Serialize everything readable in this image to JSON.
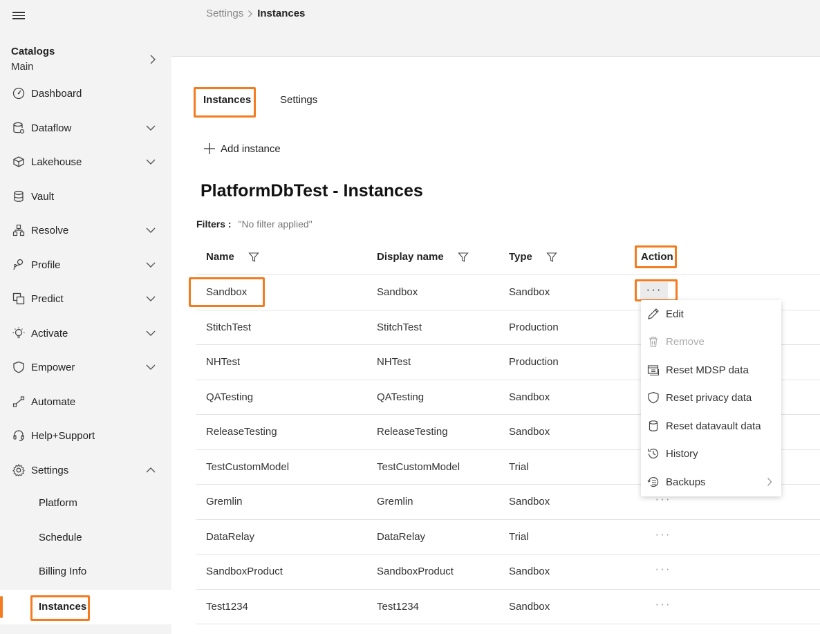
{
  "sidebar": {
    "catalogs_title": "Catalogs",
    "catalogs_sub": "Main",
    "items": [
      {
        "label": "Dashboard",
        "icon": "dashboard-icon",
        "chevron": false
      },
      {
        "label": "Dataflow",
        "icon": "dataflow-icon",
        "chevron": true
      },
      {
        "label": "Lakehouse",
        "icon": "cube-icon",
        "chevron": true
      },
      {
        "label": "Vault",
        "icon": "database-icon",
        "chevron": false
      },
      {
        "label": "Resolve",
        "icon": "hierarchy-icon",
        "chevron": true
      },
      {
        "label": "Profile",
        "icon": "profile-icon",
        "chevron": true
      },
      {
        "label": "Predict",
        "icon": "predict-icon",
        "chevron": true
      },
      {
        "label": "Activate",
        "icon": "lightbulb-icon",
        "chevron": true
      },
      {
        "label": "Empower",
        "icon": "shield-icon",
        "chevron": true
      },
      {
        "label": "Automate",
        "icon": "automate-icon",
        "chevron": false
      },
      {
        "label": "Help+Support",
        "icon": "headset-icon",
        "chevron": false
      },
      {
        "label": "Settings",
        "icon": "gear-icon",
        "chevron": "up"
      }
    ],
    "sub_items": [
      "Platform",
      "Schedule",
      "Billing Info",
      "Instances"
    ]
  },
  "breadcrumb": {
    "parent": "Settings",
    "current": "Instances"
  },
  "tabs": [
    "Instances",
    "Settings"
  ],
  "add_instance_label": "Add instance",
  "page_title": "PlatformDbTest - Instances",
  "filters": {
    "label": "Filters :",
    "value": "\"No filter applied\""
  },
  "table": {
    "headers": [
      "Name",
      "Display name",
      "Type",
      "Action"
    ],
    "rows": [
      {
        "name": "Sandbox",
        "display": "Sandbox",
        "type": "Sandbox"
      },
      {
        "name": "StitchTest",
        "display": "StitchTest",
        "type": "Production"
      },
      {
        "name": "NHTest",
        "display": "NHTest",
        "type": "Production"
      },
      {
        "name": "QATesting",
        "display": "QATesting",
        "type": "Sandbox"
      },
      {
        "name": "ReleaseTesting",
        "display": "ReleaseTesting",
        "type": "Sandbox"
      },
      {
        "name": "TestCustomModel",
        "display": "TestCustomModel",
        "type": "Trial"
      },
      {
        "name": "Gremlin",
        "display": "Gremlin",
        "type": "Sandbox"
      },
      {
        "name": "DataRelay",
        "display": "DataRelay",
        "type": "Trial"
      },
      {
        "name": "SandboxProduct",
        "display": "SandboxProduct",
        "type": "Sandbox"
      },
      {
        "name": "Test1234",
        "display": "Test1234",
        "type": "Sandbox"
      }
    ]
  },
  "action_menu": {
    "items": [
      {
        "label": "Edit",
        "icon": "pencil-icon",
        "disabled": false
      },
      {
        "label": "Remove",
        "icon": "trash-icon",
        "disabled": true
      },
      {
        "label": "Reset MDSP data",
        "icon": "reset-mdsp-icon",
        "disabled": false
      },
      {
        "label": "Reset privacy data",
        "icon": "shield-icon",
        "disabled": false
      },
      {
        "label": "Reset datavault data",
        "icon": "database-icon",
        "disabled": false
      },
      {
        "label": "History",
        "icon": "history-icon",
        "disabled": false
      },
      {
        "label": "Backups",
        "icon": "backup-icon",
        "disabled": false,
        "submenu": true
      }
    ]
  },
  "colors": {
    "accent": "#f47b20",
    "sidebar_bg": "#f3f3f3"
  }
}
